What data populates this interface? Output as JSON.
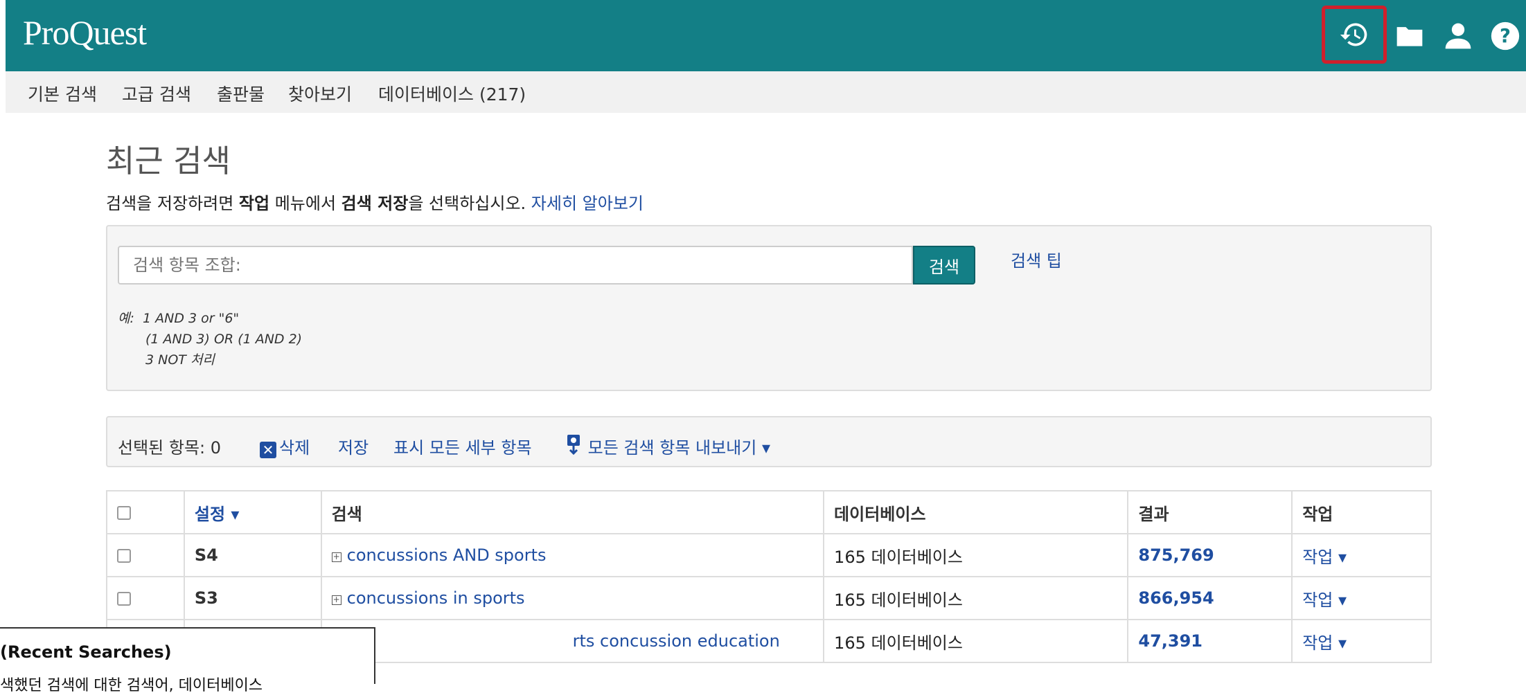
{
  "header": {
    "logo": "ProQuest",
    "icons": [
      "recent-searches-icon",
      "folder-icon",
      "user-icon",
      "help-icon"
    ],
    "brand_color": "#137f86",
    "highlight_color": "#d0202c"
  },
  "nav": {
    "items": [
      "기본 검색",
      "고급 검색",
      "출판물",
      "찾아보기",
      "데이터베이스 (217)"
    ]
  },
  "page": {
    "title": "최근 검색",
    "info_1": "검색을 저장하려면 ",
    "info_bold_1": "작업",
    "info_2": " 메뉴에서 ",
    "info_bold_2": "검색 저장",
    "info_3": "을 선택하십시오. ",
    "info_link": "자세히 알아보기"
  },
  "search": {
    "input_placeholder": "검색 항목 조합:",
    "button": "검색",
    "tips": "검색 팁",
    "example_label": "예:",
    "examples": [
      "1 AND 3 or \"6\"",
      "(1 AND 3) OR (1 AND 2)",
      "3 NOT 처리"
    ]
  },
  "toolbar": {
    "selected": "선택된 항목: 0",
    "delete": "삭제",
    "save": "저장",
    "show_details": "표시 모든 세부 항목",
    "export": "모든 검색 항목 내보내기 ▾"
  },
  "table": {
    "headers": [
      "설정 ▾",
      "검색",
      "데이터베이스",
      "결과",
      "작업"
    ],
    "rows": [
      {
        "set": "S4",
        "query": "concussions AND sports",
        "databases": "165 데이터베이스",
        "results": "875,769",
        "action": "작업 ▾"
      },
      {
        "set": "S3",
        "query": "concussions in sports",
        "databases": "165 데이터베이스",
        "results": "866,954",
        "action": "작업 ▾"
      },
      {
        "set": "",
        "query": "rts concussion education",
        "databases": "165 데이터베이스",
        "results": "47,391",
        "action": "작업 ▾"
      }
    ]
  },
  "tooltip": {
    "title": "(Recent Searches)",
    "body": "색했던 검색에 대한 검색어, 데이터베이스"
  }
}
